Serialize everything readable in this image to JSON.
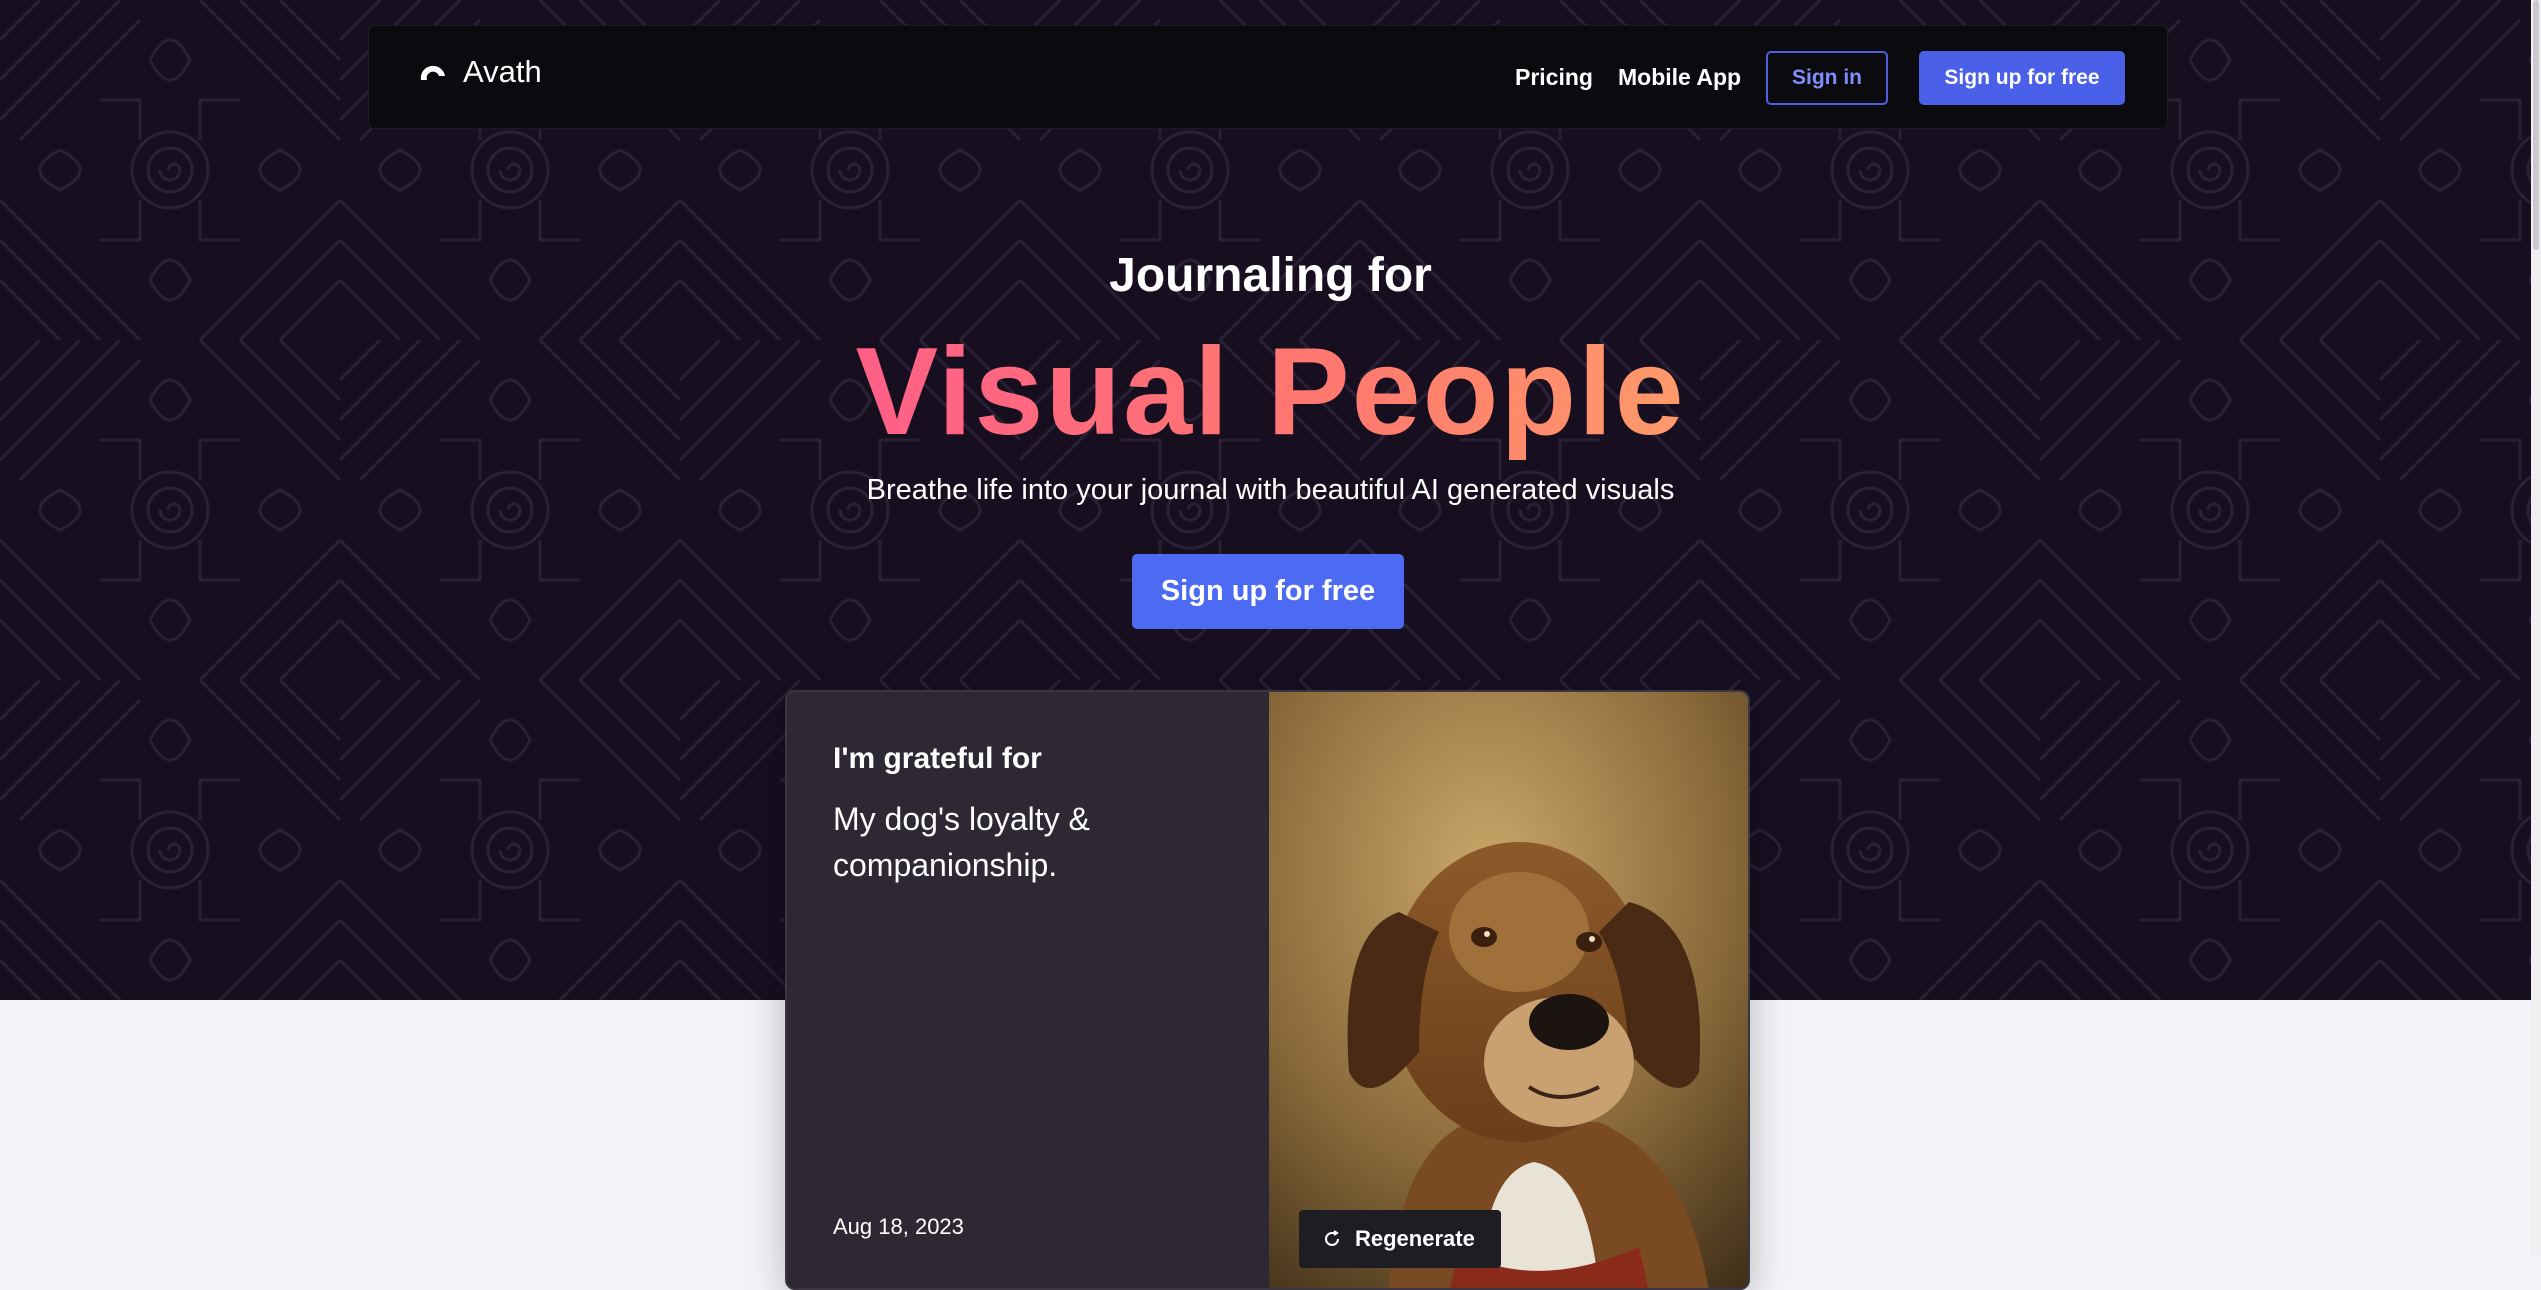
{
  "nav": {
    "brand": "Avath",
    "links": [
      "Pricing",
      "Mobile App"
    ],
    "signin_label": "Sign in",
    "signup_label": "Sign up for free"
  },
  "hero": {
    "subheading": "Journaling for",
    "headline": "Visual People",
    "tagline": "Breathe life into your journal with beautiful AI generated visuals",
    "cta_label": "Sign up for free"
  },
  "journal_card": {
    "prompt": "I'm grateful for",
    "entry": "My dog's loyalty & companionship.",
    "date": "Aug 18, 2023",
    "regenerate_label": "Regenerate",
    "image_subject": "dog-portrait"
  },
  "colors": {
    "hero_bg": "#170f20",
    "accent_blue": "#4b60e8",
    "headline_gradient": [
      "#ff5f86",
      "#ff9a6a"
    ],
    "page_bg": "#f3f4f7",
    "card_bg": "#2d2833"
  }
}
